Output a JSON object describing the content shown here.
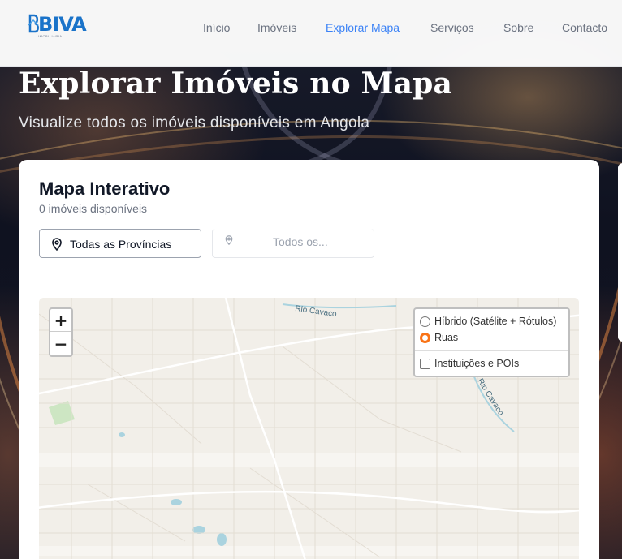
{
  "logo": {
    "text": "BIVA",
    "subtext": "IMOBILIÁRIA"
  },
  "nav": {
    "items": [
      {
        "label": "Início",
        "active": false
      },
      {
        "label": "Imóveis",
        "active": false
      },
      {
        "label": "Explorar Mapa",
        "active": true
      },
      {
        "label": "Serviços",
        "active": false
      },
      {
        "label": "Sobre",
        "active": false
      },
      {
        "label": "Contacto",
        "active": false
      }
    ]
  },
  "hero": {
    "title": "Explorar Imóveis no Mapa",
    "subtitle": "Visualize todos os imóveis disponíveis em Angola"
  },
  "card": {
    "title": "Mapa Interativo",
    "count": "0 imóveis disponíveis"
  },
  "filters": {
    "province": {
      "selected": "Todas as Províncias"
    },
    "municipality": {
      "selected": "Todos os..."
    }
  },
  "map": {
    "zoom_in": "+",
    "zoom_out": "−",
    "street_labels": [
      "Rio Cavaco",
      "Rio Cavaco"
    ],
    "layers": {
      "base": [
        {
          "label": "Híbrido (Satélite + Rótulos)",
          "checked": false
        },
        {
          "label": "Ruas",
          "checked": true
        }
      ],
      "overlay": [
        {
          "label": "Instituições e POIs",
          "checked": false
        }
      ]
    }
  },
  "colors": {
    "accent": "#3b82f6",
    "radio_checked": "#f97316",
    "map_bg": "#f2efe9"
  }
}
